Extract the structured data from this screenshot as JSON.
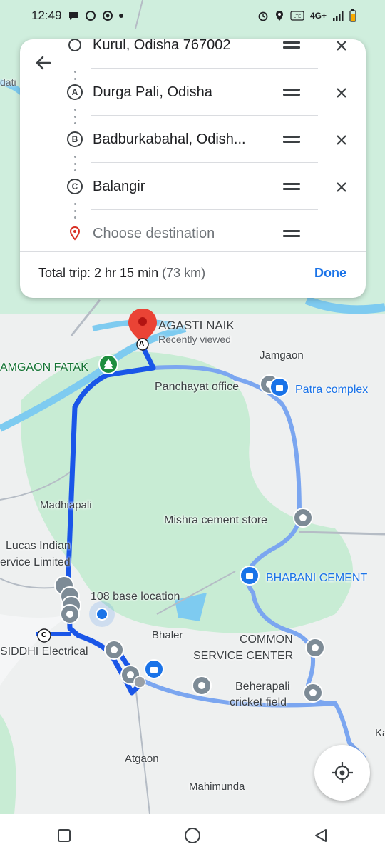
{
  "status_bar": {
    "time": "12:49",
    "net": "4G+"
  },
  "directions": {
    "stops": [
      {
        "marker": "",
        "label": "Kurul, Odisha 767002"
      },
      {
        "marker": "A",
        "label": "Durga Pali, Odisha"
      },
      {
        "marker": "B",
        "label": "Badburkabahal, Odish..."
      },
      {
        "marker": "C",
        "label": "Balangir"
      }
    ],
    "destination_placeholder": "Choose destination",
    "trip_label": "Total trip: 2 hr 15 min",
    "trip_distance": "(73 km)",
    "done_label": "Done"
  },
  "map_labels": {
    "dati": "dati",
    "agasti": "AGASTI NAIK",
    "recently": "Recently viewed",
    "jamgaon": "Jamgaon",
    "jamgaon_fatak": "AMGAON FATAK",
    "panchayat": "Panchayat office",
    "patra": "Patra complex",
    "madhiapali": "Madhiapali",
    "mishra": "Mishra cement store",
    "lucas1": "Lucas Indian",
    "lucas2": "ervice Limited",
    "bhabani": "BHABANI CEMENT",
    "base108": "108 base location",
    "bhaler": "Bhaler",
    "common1": "COMMON",
    "common2": "SERVICE CENTER",
    "siddhi": "SIDDHI Electrical",
    "beherapali1": "Beherapali",
    "beherapali2": "cricket field",
    "atgaon": "Atgaon",
    "mahimunda": "Mahimunda",
    "ka": "Ka"
  },
  "pin_markers": {
    "a": "A",
    "c": "C"
  },
  "colors": {
    "route": "#1a56e8",
    "alt_route": "#7ba6f0",
    "water": "#7ecbf0",
    "green": "#c8ecd4",
    "accent": "#1a73e8"
  }
}
